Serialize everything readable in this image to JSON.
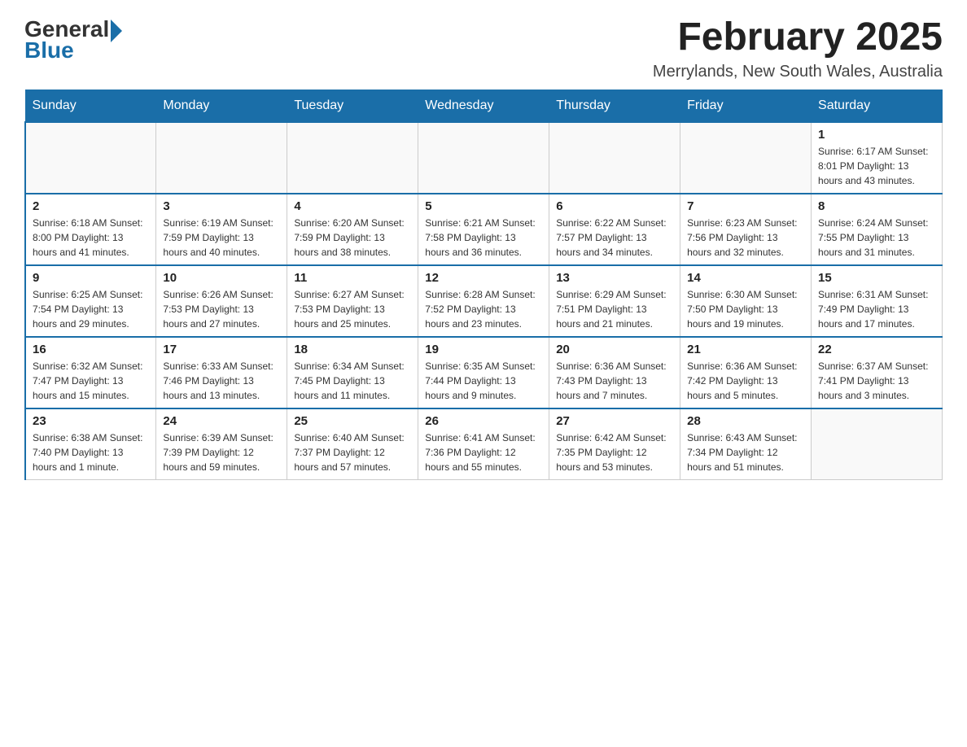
{
  "header": {
    "logo_general": "General",
    "logo_blue": "Blue",
    "title": "February 2025",
    "subtitle": "Merrylands, New South Wales, Australia"
  },
  "days_of_week": [
    "Sunday",
    "Monday",
    "Tuesday",
    "Wednesday",
    "Thursday",
    "Friday",
    "Saturday"
  ],
  "weeks": [
    [
      {
        "day": "",
        "info": ""
      },
      {
        "day": "",
        "info": ""
      },
      {
        "day": "",
        "info": ""
      },
      {
        "day": "",
        "info": ""
      },
      {
        "day": "",
        "info": ""
      },
      {
        "day": "",
        "info": ""
      },
      {
        "day": "1",
        "info": "Sunrise: 6:17 AM\nSunset: 8:01 PM\nDaylight: 13 hours and 43 minutes."
      }
    ],
    [
      {
        "day": "2",
        "info": "Sunrise: 6:18 AM\nSunset: 8:00 PM\nDaylight: 13 hours and 41 minutes."
      },
      {
        "day": "3",
        "info": "Sunrise: 6:19 AM\nSunset: 7:59 PM\nDaylight: 13 hours and 40 minutes."
      },
      {
        "day": "4",
        "info": "Sunrise: 6:20 AM\nSunset: 7:59 PM\nDaylight: 13 hours and 38 minutes."
      },
      {
        "day": "5",
        "info": "Sunrise: 6:21 AM\nSunset: 7:58 PM\nDaylight: 13 hours and 36 minutes."
      },
      {
        "day": "6",
        "info": "Sunrise: 6:22 AM\nSunset: 7:57 PM\nDaylight: 13 hours and 34 minutes."
      },
      {
        "day": "7",
        "info": "Sunrise: 6:23 AM\nSunset: 7:56 PM\nDaylight: 13 hours and 32 minutes."
      },
      {
        "day": "8",
        "info": "Sunrise: 6:24 AM\nSunset: 7:55 PM\nDaylight: 13 hours and 31 minutes."
      }
    ],
    [
      {
        "day": "9",
        "info": "Sunrise: 6:25 AM\nSunset: 7:54 PM\nDaylight: 13 hours and 29 minutes."
      },
      {
        "day": "10",
        "info": "Sunrise: 6:26 AM\nSunset: 7:53 PM\nDaylight: 13 hours and 27 minutes."
      },
      {
        "day": "11",
        "info": "Sunrise: 6:27 AM\nSunset: 7:53 PM\nDaylight: 13 hours and 25 minutes."
      },
      {
        "day": "12",
        "info": "Sunrise: 6:28 AM\nSunset: 7:52 PM\nDaylight: 13 hours and 23 minutes."
      },
      {
        "day": "13",
        "info": "Sunrise: 6:29 AM\nSunset: 7:51 PM\nDaylight: 13 hours and 21 minutes."
      },
      {
        "day": "14",
        "info": "Sunrise: 6:30 AM\nSunset: 7:50 PM\nDaylight: 13 hours and 19 minutes."
      },
      {
        "day": "15",
        "info": "Sunrise: 6:31 AM\nSunset: 7:49 PM\nDaylight: 13 hours and 17 minutes."
      }
    ],
    [
      {
        "day": "16",
        "info": "Sunrise: 6:32 AM\nSunset: 7:47 PM\nDaylight: 13 hours and 15 minutes."
      },
      {
        "day": "17",
        "info": "Sunrise: 6:33 AM\nSunset: 7:46 PM\nDaylight: 13 hours and 13 minutes."
      },
      {
        "day": "18",
        "info": "Sunrise: 6:34 AM\nSunset: 7:45 PM\nDaylight: 13 hours and 11 minutes."
      },
      {
        "day": "19",
        "info": "Sunrise: 6:35 AM\nSunset: 7:44 PM\nDaylight: 13 hours and 9 minutes."
      },
      {
        "day": "20",
        "info": "Sunrise: 6:36 AM\nSunset: 7:43 PM\nDaylight: 13 hours and 7 minutes."
      },
      {
        "day": "21",
        "info": "Sunrise: 6:36 AM\nSunset: 7:42 PM\nDaylight: 13 hours and 5 minutes."
      },
      {
        "day": "22",
        "info": "Sunrise: 6:37 AM\nSunset: 7:41 PM\nDaylight: 13 hours and 3 minutes."
      }
    ],
    [
      {
        "day": "23",
        "info": "Sunrise: 6:38 AM\nSunset: 7:40 PM\nDaylight: 13 hours and 1 minute."
      },
      {
        "day": "24",
        "info": "Sunrise: 6:39 AM\nSunset: 7:39 PM\nDaylight: 12 hours and 59 minutes."
      },
      {
        "day": "25",
        "info": "Sunrise: 6:40 AM\nSunset: 7:37 PM\nDaylight: 12 hours and 57 minutes."
      },
      {
        "day": "26",
        "info": "Sunrise: 6:41 AM\nSunset: 7:36 PM\nDaylight: 12 hours and 55 minutes."
      },
      {
        "day": "27",
        "info": "Sunrise: 6:42 AM\nSunset: 7:35 PM\nDaylight: 12 hours and 53 minutes."
      },
      {
        "day": "28",
        "info": "Sunrise: 6:43 AM\nSunset: 7:34 PM\nDaylight: 12 hours and 51 minutes."
      },
      {
        "day": "",
        "info": ""
      }
    ]
  ]
}
